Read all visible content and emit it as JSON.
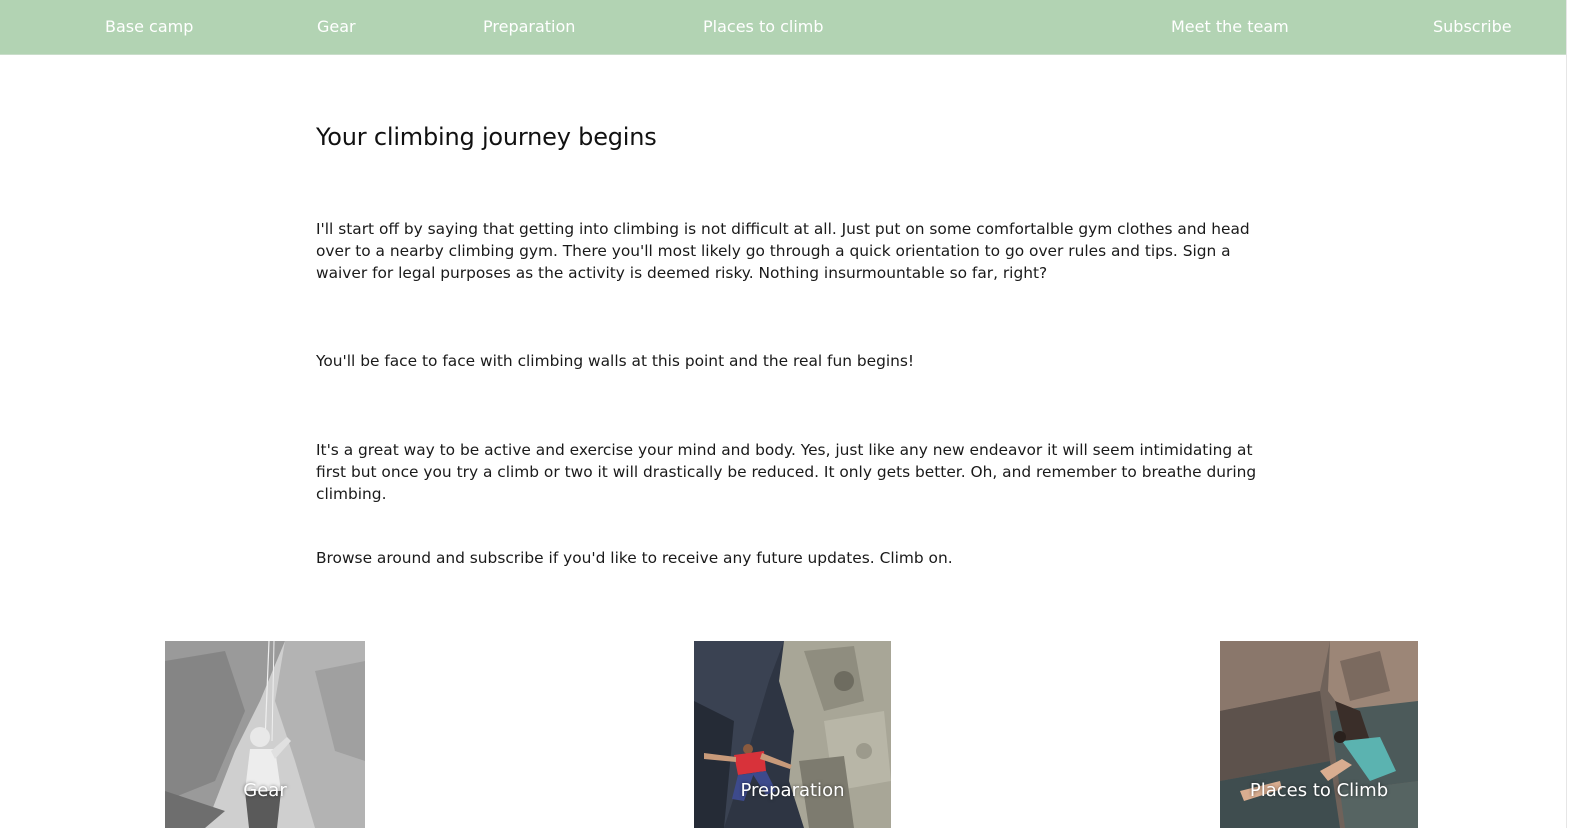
{
  "nav": {
    "items": [
      {
        "label": "Base camp"
      },
      {
        "label": "Gear"
      },
      {
        "label": "Preparation"
      },
      {
        "label": "Places to climb"
      },
      {
        "label": "Meet the team"
      },
      {
        "label": "Subscribe"
      }
    ]
  },
  "main": {
    "title": "Your climbing journey begins",
    "paragraphs": [
      "I'll start off by saying that getting into climbing is not difficult at all. Just put on some comfortalble gym clothes and head over to a nearby climbing gym. There you'll most likely go through a quick orientation to go over rules and tips. Sign a waiver for legal purposes as the activity is deemed risky. Nothing insurmountable so far, right?",
      "You'll be face to face with climbing walls at this point and the real fun begins!",
      "It's a great way to be active and exercise your mind and body. Yes, just like any new endeavor it will seem intimidating at first but once you try a climb or two it will drastically be reduced. It only gets better. Oh, and remember to breathe during climbing.",
      "Browse around and subscribe if you'd like to receive any future updates. Climb on."
    ]
  },
  "cards": [
    {
      "label": "Gear"
    },
    {
      "label": "Preparation"
    },
    {
      "label": "Places to Climb"
    }
  ],
  "colors": {
    "nav_background": "#b2d3b3",
    "nav_text": "#ffffff",
    "body_text": "#1a1a1a"
  }
}
